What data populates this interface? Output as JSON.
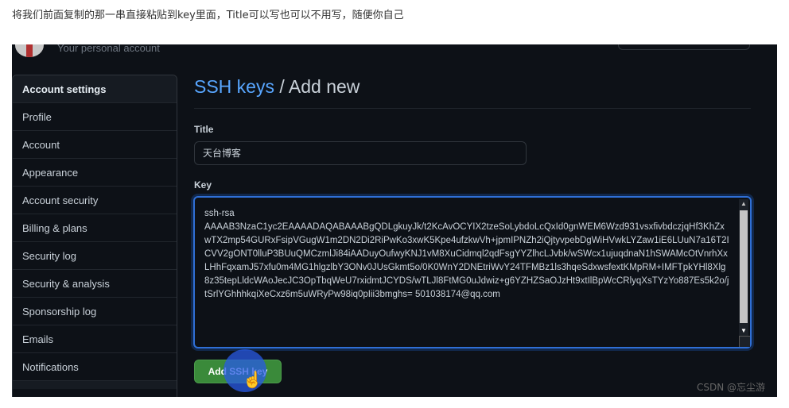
{
  "caption": "将我们前面复制的那一串直接粘贴到key里面，Title可以写也可以不用写，随便你自己",
  "header": {
    "personal_account": "Your personal account"
  },
  "sidebar": {
    "items": [
      {
        "label": "Account settings"
      },
      {
        "label": "Profile"
      },
      {
        "label": "Account"
      },
      {
        "label": "Appearance"
      },
      {
        "label": "Account security"
      },
      {
        "label": "Billing & plans"
      },
      {
        "label": "Security log"
      },
      {
        "label": "Security & analysis"
      },
      {
        "label": "Sponsorship log"
      },
      {
        "label": "Emails"
      },
      {
        "label": "Notifications"
      }
    ]
  },
  "main": {
    "heading_link": "SSH keys",
    "heading_sep": " / ",
    "heading_rest": "Add new",
    "title_label": "Title",
    "title_value": "天台博客",
    "key_label": "Key",
    "key_value": "ssh-rsa\nAAAAB3NzaC1yc2EAAAADAQABAAABgQDLgkuyJk/t2KcAvOCYIX2tzeSoLybdoLcQxId0gnWEM6Wzd931vsxfivbdczjqHf3KhZxwTX2mp54GURxFsipVGugW1m2DN2Di2RiPwKo3xwK5Kpe4ufzkwVh+jpmIPNZh2iQjtyvpebDgWiHVwkLYZaw1iE6LUuN7a16T2ICVV2gONT0lluP3BUuQMCzmlJi84iAADuyOufwyKNJ1vM8XuCidmql2qdFsgYYZlhcLJvbk/wSWcx1ujuqdnaN1hSWAMcOtVnrhXxLHhFqxamJ57xfu0m4MG1hlgzlbY3ONv0JUsGkmt5o/0K0WnY2DNEtriWvY24TFMBz1ls3hqeSdxwsfextKMpRM+IMFTpkYHl8Xlg8z35tepLldcWAoJecJC3OpTbqWeU7rxidmtJCYDS/wTLJl8FtMG0uJdwiz+g6YZHZSaOJzHt9xtIlBpWcCRlyqXsTYzYo887Es5k2o/jtSrlYGhhhkqiXeCxz6m5uWRyPw98iq0pIii3bmghs= 501038174@qq.com",
    "add_button": "Add SSH key"
  },
  "watermark": "CSDN @忘尘游",
  "colors": {
    "link": "#58a6ff",
    "button": "#3a8a3a",
    "focus": "#2f6fd6",
    "bg": "#0d1117"
  }
}
